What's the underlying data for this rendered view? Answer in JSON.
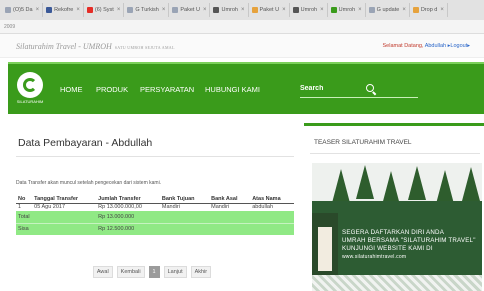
{
  "browser": {
    "tabs": [
      {
        "label": "(O)5 Da",
        "icon": "page-icon",
        "color": "#9aa4b5"
      },
      {
        "label": "Rekofre",
        "icon": "facebook-icon",
        "color": "#3b5998"
      },
      {
        "label": "(6) Syst",
        "icon": "youtube-icon",
        "color": "#e52d27"
      },
      {
        "label": "G Turkish",
        "icon": "google-icon",
        "color": "#9aa4b5"
      },
      {
        "label": "Paket U",
        "icon": "page-icon",
        "color": "#9aa4b5"
      },
      {
        "label": "Umroh",
        "icon": "page-icon",
        "color": "#555555"
      },
      {
        "label": "Paket U",
        "icon": "folder-icon",
        "color": "#e6a23c"
      },
      {
        "label": "Umroh",
        "icon": "page-icon",
        "color": "#555555"
      },
      {
        "label": "Umroh",
        "icon": "pencil-icon",
        "color": "#3a9b1b"
      },
      {
        "label": "G update",
        "icon": "google-icon",
        "color": "#9aa4b5"
      },
      {
        "label": "Drop d",
        "icon": "page-icon",
        "color": "#e6a23c"
      }
    ],
    "url_fragment": "2009"
  },
  "header": {
    "site_title": "Silaturahim Travel - UMROH",
    "site_tagline": "SATU UMROH SEJUTA AMAL",
    "welcome_prefix": "Selamat Datang,",
    "welcome_user": "Abdullah",
    "logout_label": "▸Logout▸"
  },
  "nav": {
    "logo_caption": "SILATURAHIM",
    "items": [
      "HOME",
      "PRODUK",
      "PERSYARATAN",
      "HUBUNGI KAMI"
    ],
    "search_placeholder": "Search",
    "brand_color": "#3a9b1b"
  },
  "main": {
    "title": "Data Pembayaran - Abdullah",
    "info": "Data Transfer akan muncul setelah pengecekan dari sistem kami.",
    "columns": [
      "No",
      "Tanggal Transfer",
      "Jumlah Transfer",
      "Bank Tujuan",
      "Bank Asal",
      "Atas Nama"
    ],
    "rows": [
      [
        "1",
        "05 Agu 2017",
        "Rp 13.000.000,00",
        "Mandiri",
        "Mandiri",
        "abdullah"
      ]
    ],
    "total_label": "Total",
    "total_value": "Rp 13.000.000",
    "sisa_label": "Sisa",
    "sisa_value": "Rp 12.500.000",
    "highlight_color": "#90e985"
  },
  "pager": {
    "first": "Awal",
    "prev": "Kembali",
    "current": "1",
    "next": "Lanjut",
    "last": "Akhir"
  },
  "sidebar": {
    "title": "TEASER SILATURAHIM TRAVEL",
    "teaser_lines": [
      "SEGERA DAFTARKAN DIRI ANDA",
      "UMRAH BERSAMA \"SILATURAHIM TRAVEL\"",
      "KUNJUNGI WEBSITE KAMI DI"
    ],
    "teaser_url": "www.silaturahimtravel.com"
  }
}
